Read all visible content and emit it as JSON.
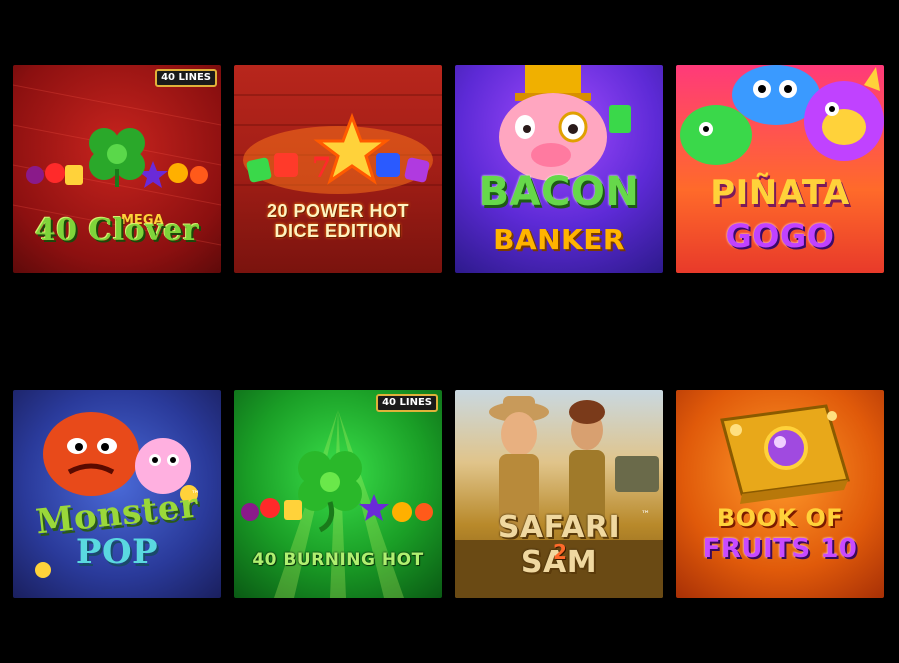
{
  "games": [
    {
      "id": "t1",
      "title_main": "40 Clover",
      "title_prefix": "MEGA",
      "badge": "40 LINES"
    },
    {
      "id": "t2",
      "title_line1": "20 POWER HOT",
      "title_line2": "DICE EDITION"
    },
    {
      "id": "t3",
      "title_line1": "BACON",
      "title_line2": "BANKER"
    },
    {
      "id": "t4",
      "title_line1": "PIÑATA",
      "title_line2": "GOGO"
    },
    {
      "id": "t5",
      "title_line1": "Monster",
      "title_line2": "POP",
      "tm": "™"
    },
    {
      "id": "t6",
      "title_main": "40 BURNING HOT",
      "badge": "40 LINES"
    },
    {
      "id": "t7",
      "title_main": "SAFARI SAM",
      "number": "2",
      "tm": "™"
    },
    {
      "id": "t8",
      "title_line1": "BOOK OF",
      "title_line2": "FRUITS 10"
    }
  ],
  "colors": {
    "page_background": "#000000",
    "badge_border": "#e0b23a"
  }
}
